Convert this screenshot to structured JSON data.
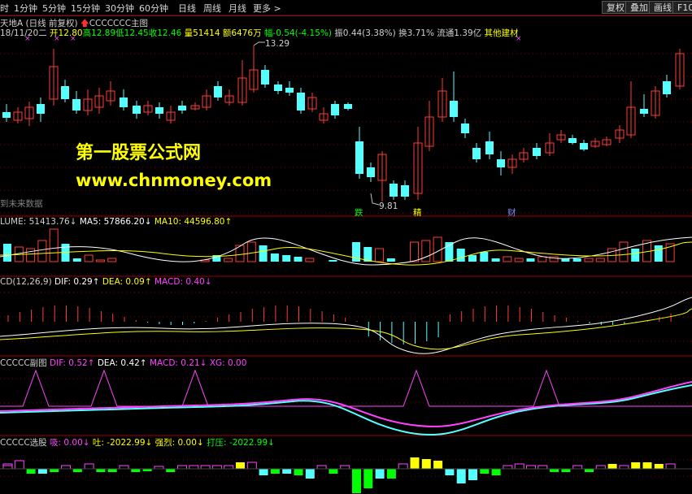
{
  "toolbar": {
    "periods": [
      "时",
      "1分钟",
      "5分钟",
      "15分钟",
      "30分钟",
      "60分钟",
      "日线",
      "周线",
      "月线",
      "更多 >"
    ],
    "buttons": [
      "复权",
      "叠加",
      "画线",
      "F10"
    ]
  },
  "main": {
    "stock_name": "天地A",
    "chart_mode": "(日线 前复权)",
    "formula_name": "CCCCCCC主图",
    "quote": {
      "date": "18/11/20二",
      "open": "开12.80",
      "high": "高12.89",
      "low": "低12.45",
      "close": "收12.46",
      "volume": "量51414",
      "amount": "额6476万",
      "change": "幅-0.54(-4.15%)",
      "amplitude": "振0.44(3.38%)",
      "turnover": "换3.71%",
      "float_cap": "流通1.39亿",
      "sector": "其他建材"
    },
    "high_mark": "13.29",
    "low_mark": "9.81",
    "future_label": "到未来数据",
    "signals": [
      "跌",
      "精",
      "财"
    ]
  },
  "watermark": {
    "title": "第一股票公式网",
    "url": "www.chnmoney.com"
  },
  "volume_panel": {
    "label": "LUME: 51413.76↓",
    "ma5": "MA5: 57866.20↓",
    "ma10": "MA10: 44596.80↑"
  },
  "macd_panel": {
    "label": "CD(12,26,9)",
    "dif": "DIF: 0.29↑",
    "dea": "DEA: 0.09↑",
    "macd": "MACD: 0.40↓"
  },
  "sub_panel": {
    "label": "CCCCC副图",
    "dif": "DIF: 0.52↑",
    "dea": "DEA: 0.42↑",
    "macd": "MACD: 0.21↓",
    "xg": "XG: 0.00"
  },
  "select_panel": {
    "label": "CCCCC选股",
    "xi": "吸: 0.00↓",
    "tu": "吐: -2022.99↓",
    "qiang": "强烈: 0.00↓",
    "daya": "打压: -2022.99↓"
  },
  "colors": {
    "up": "#ff3c3c",
    "down": "#54ffff",
    "yellow": "#ffff00",
    "magenta": "#ff44ff",
    "green": "#00ff00",
    "white": "#ffffff",
    "grid": "#800000"
  }
}
